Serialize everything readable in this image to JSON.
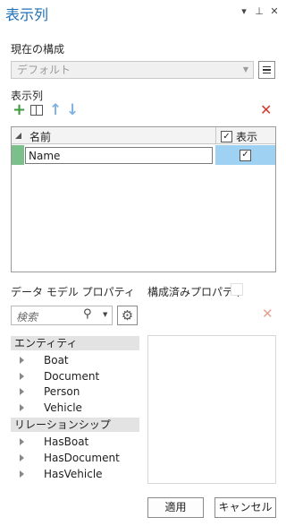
{
  "pane": {
    "title": "表示列",
    "controls": {
      "dropdown": "▾",
      "pin": "ф",
      "close": "×"
    }
  },
  "config": {
    "label": "現在の構成",
    "selected": "デフォルト"
  },
  "columns": {
    "label": "表示列",
    "header_name": "名前",
    "header_show": "表示",
    "rows": [
      {
        "name": "Name",
        "show": true
      }
    ]
  },
  "properties": {
    "data_model_label": "データ モデル プロパティ",
    "configured_label": "構成済みプロパティ",
    "search_placeholder": "検索"
  },
  "tree": {
    "groups": [
      {
        "label": "エンティティ",
        "items": [
          "Boat",
          "Document",
          "Person",
          "Vehicle"
        ]
      },
      {
        "label": "リレーションシップ",
        "items": [
          "HasBoat",
          "HasDocument",
          "HasVehicle"
        ]
      }
    ]
  },
  "buttons": {
    "apply": "適用",
    "cancel": "キャンセル"
  },
  "colors": {
    "title": "#1f6fb5",
    "add": "#3d9a3d",
    "delete": "#d23a2a",
    "selected_cell": "#9fd1f2",
    "row_marker": "#7bbf8a"
  },
  "icons": {
    "add": "plus-icon",
    "field": "field-icon",
    "move_up": "arrow-up-icon",
    "move_down": "arrow-down-icon",
    "delete": "x-icon",
    "search": "magnifier-icon",
    "settings": "gear-icon"
  }
}
